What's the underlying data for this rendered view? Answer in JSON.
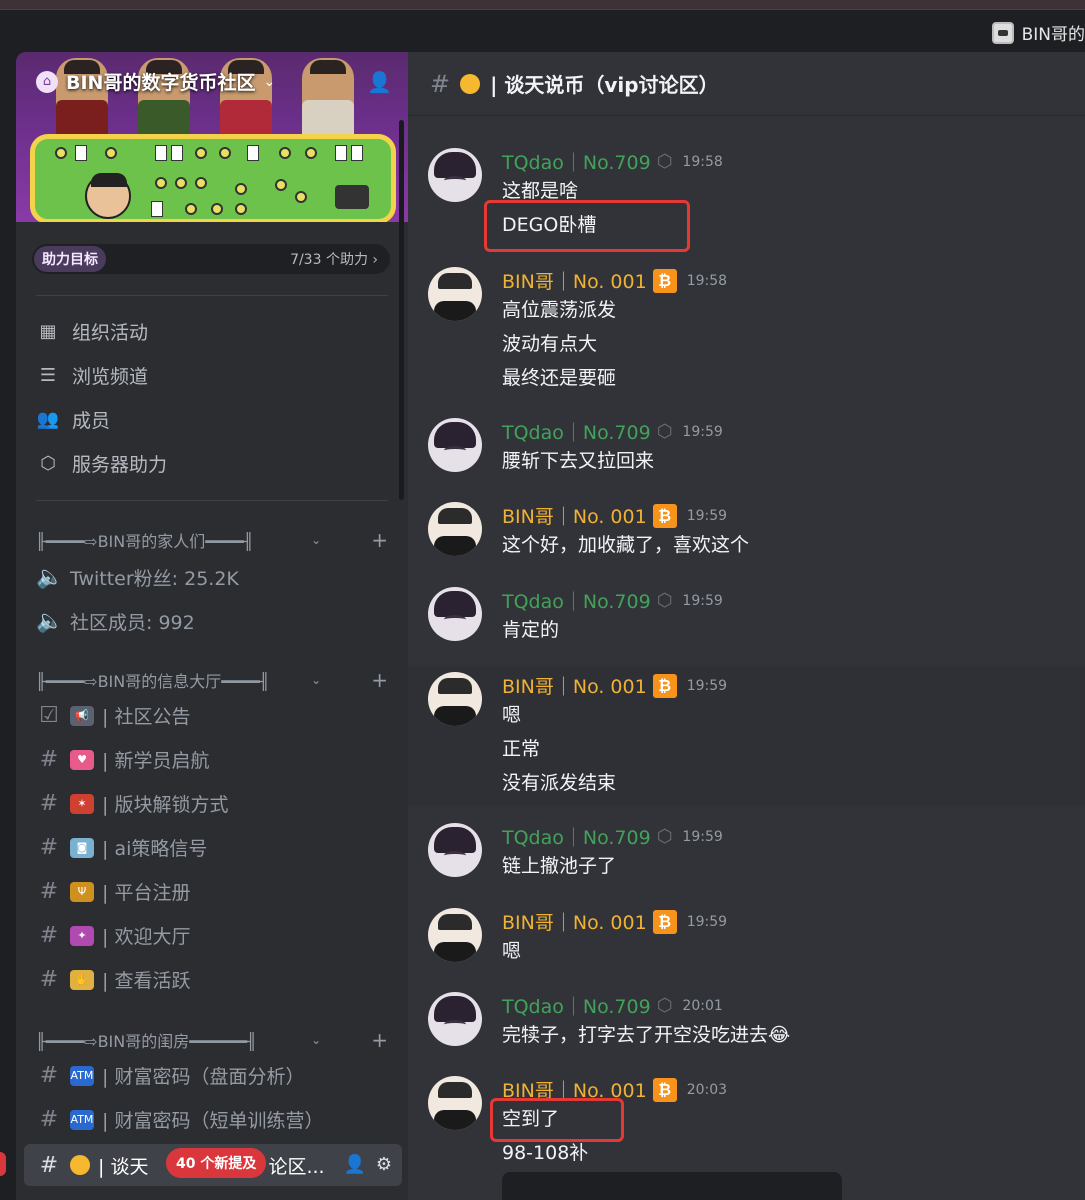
{
  "titlebar": {
    "user_label": "BIN哥的"
  },
  "server": {
    "name": "BIN哥的数字货币社区",
    "boost_label": "助力目标",
    "boost_count": "7/33 个助力 ›"
  },
  "menu": [
    {
      "label": "组织活动",
      "icon": "calendar-icon"
    },
    {
      "label": "浏览频道",
      "icon": "browse-channels-icon"
    },
    {
      "label": "成员",
      "icon": "members-icon"
    },
    {
      "label": "服务器助力",
      "icon": "boost-icon"
    }
  ],
  "categories": [
    {
      "label": "╟━━━━⇨BIN哥的家人们━━━━╢"
    },
    {
      "label": "╟━━━━⇨BIN哥的信息大厅━━━━╢"
    },
    {
      "label": "╟━━━━⇨BIN哥的闺房━━━━━━╢"
    }
  ],
  "channels": {
    "twitter": "Twitter粉丝: 25.2K",
    "members": "社区成员: 992",
    "announce": "| 社区公告",
    "newbie": "| 新学员启航",
    "unlock": "| 版块解锁方式",
    "ai": "| ai策略信号",
    "register": "| 平台注册",
    "welcome": "| 欢迎大厅",
    "active": "| 查看活跃",
    "wealth1": "| 财富密码（盘面分析）",
    "wealth2": "| 财富密码（短单训练营）",
    "current_a": "| 谈天",
    "current_b": "论区...",
    "new_mentions": "40 个新提及"
  },
  "chat": {
    "title": "| 谈天说币（vip讨论区）",
    "messages": [
      {
        "user": "TQdao｜No.709",
        "time": "19:58",
        "lines": [
          "这都是啥",
          "DEGO卧槽"
        ]
      },
      {
        "user": "BIN哥｜No. 001",
        "time": "19:58",
        "lines": [
          "高位震荡派发",
          "波动有点大",
          "最终还是要砸"
        ]
      },
      {
        "user": "TQdao｜No.709",
        "time": "19:59",
        "lines": [
          "腰斩下去又拉回来"
        ]
      },
      {
        "user": "BIN哥｜No. 001",
        "time": "19:59",
        "lines": [
          "这个好，加收藏了，喜欢这个"
        ]
      },
      {
        "user": "TQdao｜No.709",
        "time": "19:59",
        "lines": [
          "肯定的"
        ]
      },
      {
        "user": "BIN哥｜No. 001",
        "time": "19:59",
        "lines": [
          "嗯",
          "正常",
          "没有派发结束"
        ]
      },
      {
        "user": "TQdao｜No.709",
        "time": "19:59",
        "lines": [
          "链上撤池子了"
        ]
      },
      {
        "user": "BIN哥｜No. 001",
        "time": "19:59",
        "lines": [
          "嗯"
        ]
      },
      {
        "user": "TQdao｜No.709",
        "time": "20:01",
        "lines": [
          "完犊子，打字去了开空没吃进去😂"
        ]
      },
      {
        "user": "BIN哥｜No. 001",
        "time": "20:03",
        "lines": [
          "空到了",
          "98-108补"
        ]
      }
    ],
    "btc_glyph": "₿",
    "cube_glyph": "⬡"
  }
}
